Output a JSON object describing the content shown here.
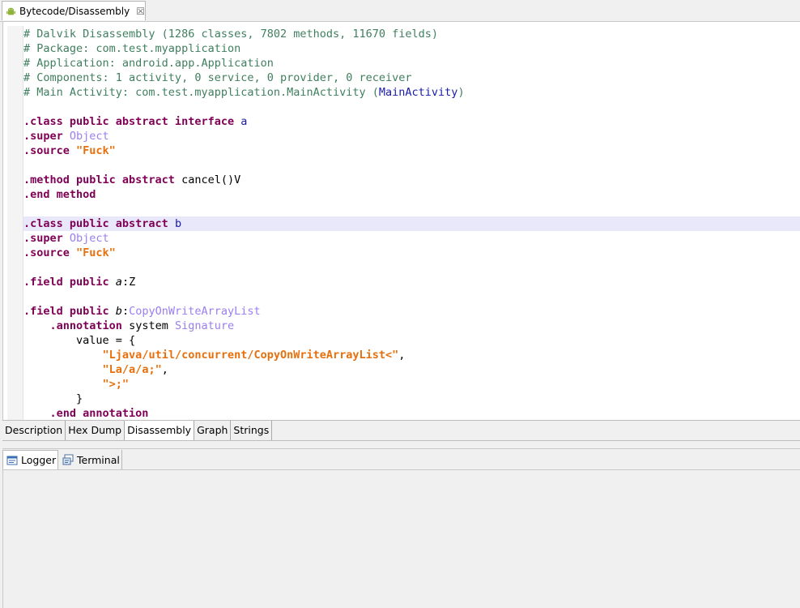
{
  "editor": {
    "tab_title": "Bytecode/Disassembly",
    "tab_icon": "android-icon",
    "close_glyph": "☒"
  },
  "code_lines": [
    {
      "tokens": [
        {
          "t": "# Dalvik Disassembly (1286 classes, 7802 methods, 11670 fields)",
          "c": "cm"
        }
      ]
    },
    {
      "tokens": [
        {
          "t": "# Package: com.test.myapplication",
          "c": "cm"
        }
      ]
    },
    {
      "tokens": [
        {
          "t": "# Application: android.app.Application",
          "c": "cm"
        }
      ]
    },
    {
      "tokens": [
        {
          "t": "# Components: 1 activity, 0 service, 0 provider, 0 receiver",
          "c": "cm"
        }
      ]
    },
    {
      "tokens": [
        {
          "t": "# Main Activity: com.test.myapplication.MainActivity (",
          "c": "cm"
        },
        {
          "t": "MainActivity",
          "c": "id"
        },
        {
          "t": ")",
          "c": "cm"
        }
      ]
    },
    {
      "tokens": []
    },
    {
      "tokens": [
        {
          "t": ".class public abstract interface ",
          "c": "kw"
        },
        {
          "t": "a",
          "c": "id"
        }
      ]
    },
    {
      "tokens": [
        {
          "t": ".super ",
          "c": "kw"
        },
        {
          "t": "Object",
          "c": "ty"
        }
      ]
    },
    {
      "tokens": [
        {
          "t": ".source ",
          "c": "kw"
        },
        {
          "t": "\"Fuck\"",
          "c": "st"
        }
      ]
    },
    {
      "tokens": []
    },
    {
      "tokens": [
        {
          "t": ".method public abstract ",
          "c": "kw"
        },
        {
          "t": "cancel()V",
          "c": ""
        }
      ]
    },
    {
      "tokens": [
        {
          "t": ".end method",
          "c": "kw"
        }
      ]
    },
    {
      "tokens": []
    },
    {
      "hl": true,
      "tokens": [
        {
          "t": ".class public abstract ",
          "c": "kw"
        },
        {
          "t": "b",
          "c": "id"
        }
      ]
    },
    {
      "tokens": [
        {
          "t": ".super ",
          "c": "kw"
        },
        {
          "t": "Object",
          "c": "ty"
        }
      ]
    },
    {
      "tokens": [
        {
          "t": ".source ",
          "c": "kw"
        },
        {
          "t": "\"Fuck\"",
          "c": "st"
        }
      ]
    },
    {
      "tokens": []
    },
    {
      "tokens": [
        {
          "t": ".field public ",
          "c": "kw"
        },
        {
          "t": "a",
          "c": "it"
        },
        {
          "t": ":Z",
          "c": ""
        }
      ]
    },
    {
      "tokens": []
    },
    {
      "tokens": [
        {
          "t": ".field public ",
          "c": "kw"
        },
        {
          "t": "b",
          "c": "it"
        },
        {
          "t": ":",
          "c": ""
        },
        {
          "t": "CopyOnWriteArrayList",
          "c": "ty"
        }
      ]
    },
    {
      "tokens": [
        {
          "t": "    ",
          "c": ""
        },
        {
          "t": ".annotation ",
          "c": "kw"
        },
        {
          "t": "system ",
          "c": ""
        },
        {
          "t": "Signature",
          "c": "ty"
        }
      ]
    },
    {
      "tokens": [
        {
          "t": "        value = {",
          "c": ""
        }
      ]
    },
    {
      "tokens": [
        {
          "t": "            ",
          "c": ""
        },
        {
          "t": "\"Ljava/util/concurrent/CopyOnWriteArrayList<\"",
          "c": "st"
        },
        {
          "t": ",",
          "c": ""
        }
      ]
    },
    {
      "tokens": [
        {
          "t": "            ",
          "c": ""
        },
        {
          "t": "\"La/a/a;\"",
          "c": "st"
        },
        {
          "t": ",",
          "c": ""
        }
      ]
    },
    {
      "tokens": [
        {
          "t": "            ",
          "c": ""
        },
        {
          "t": "\">;\"",
          "c": "st"
        }
      ]
    },
    {
      "tokens": [
        {
          "t": "        }",
          "c": ""
        }
      ]
    },
    {
      "tokens": [
        {
          "t": "    ",
          "c": ""
        },
        {
          "t": ".end annotation",
          "c": "kw"
        }
      ]
    }
  ],
  "view_tabs": [
    {
      "label": "Description",
      "active": false
    },
    {
      "label": "Hex Dump",
      "active": false
    },
    {
      "label": "Disassembly",
      "active": true
    },
    {
      "label": "Graph",
      "active": false
    },
    {
      "label": "Strings",
      "active": false
    }
  ],
  "lower_tabs": {
    "logger": {
      "label": "Logger",
      "icon": "logger-icon"
    },
    "terminal": {
      "label": "Terminal",
      "icon": "terminal-icon"
    }
  }
}
